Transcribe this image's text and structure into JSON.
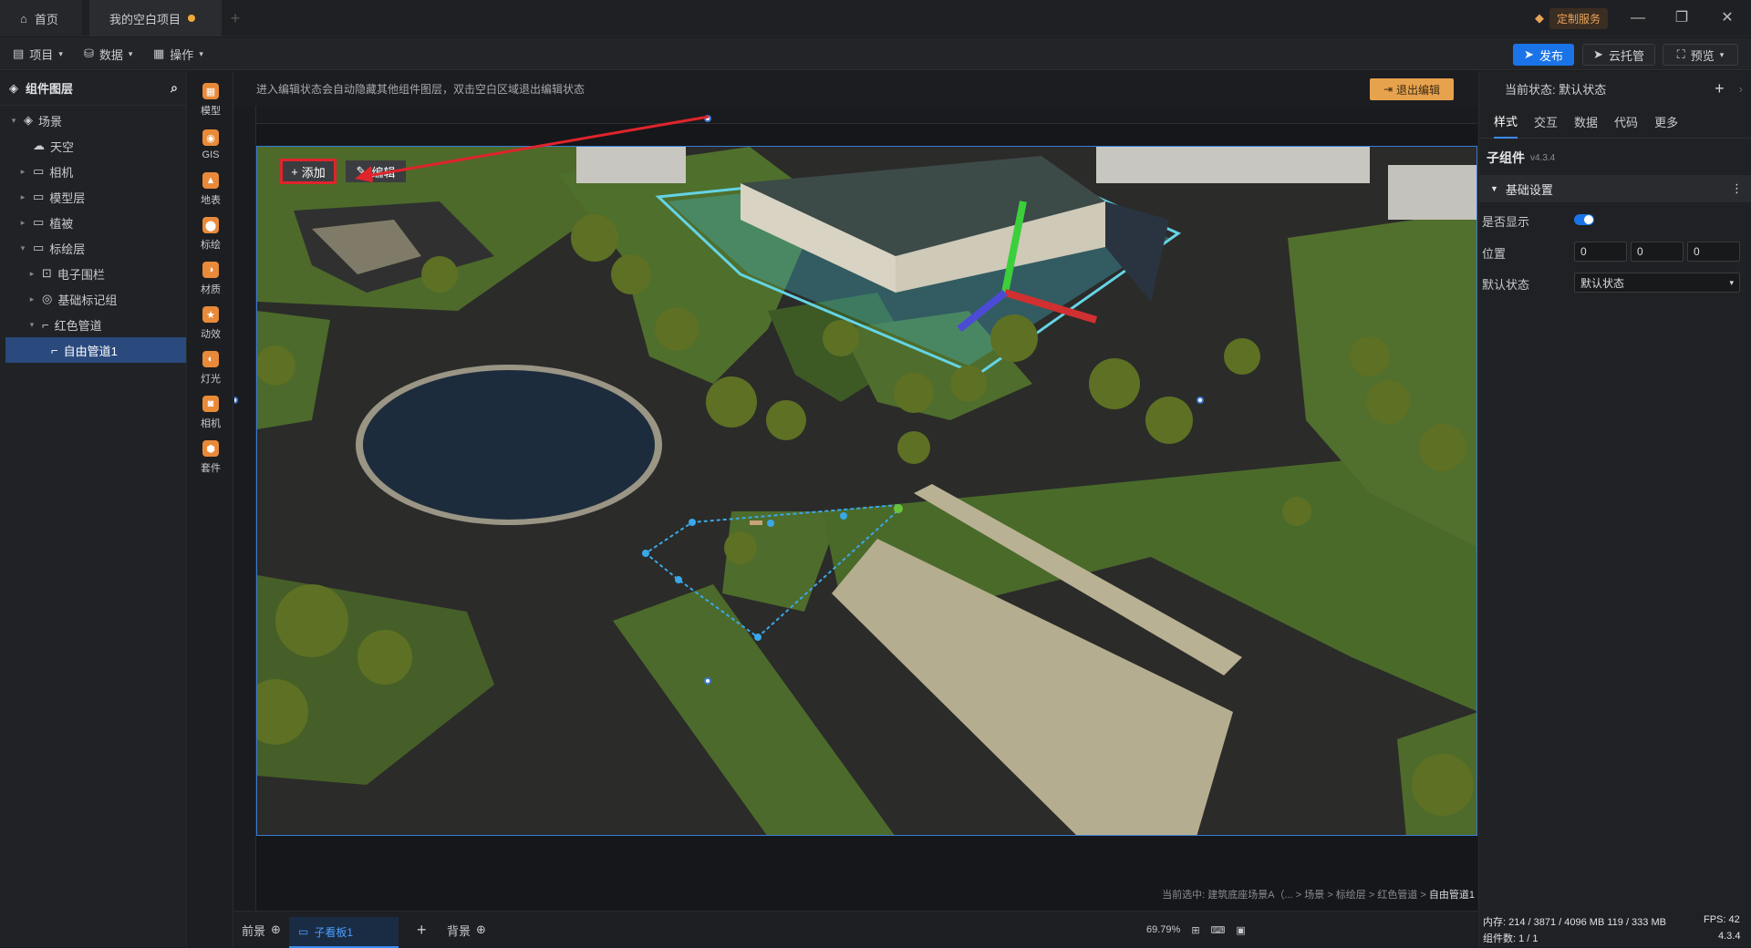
{
  "titlebar": {
    "home_tab": "首页",
    "project_tab": "我的空白项目",
    "custom_service": "定制服务",
    "win_min": "—",
    "win_restore": "❐",
    "win_close": "✕"
  },
  "menubar": {
    "project": "项目",
    "data": "数据",
    "operate": "操作",
    "publish": "发布",
    "cloud": "云托管",
    "preview": "预览"
  },
  "layers": {
    "title": "组件图层",
    "items": [
      {
        "label": "场景",
        "level": 0,
        "arrow": "▾",
        "icon": "◈"
      },
      {
        "label": "天空",
        "level": 1,
        "arrow": "",
        "icon": "☁"
      },
      {
        "label": "相机",
        "level": 1,
        "arrow": "▸",
        "icon": "▭"
      },
      {
        "label": "模型层",
        "level": 1,
        "arrow": "▸",
        "icon": "▭"
      },
      {
        "label": "植被",
        "level": 1,
        "arrow": "▸",
        "icon": "▭"
      },
      {
        "label": "标绘层",
        "level": 1,
        "arrow": "▾",
        "icon": "▭"
      },
      {
        "label": "电子围栏",
        "level": 2,
        "arrow": "▸",
        "icon": "⊡"
      },
      {
        "label": "基础标记组",
        "level": 2,
        "arrow": "▸",
        "icon": "◎"
      },
      {
        "label": "红色管道",
        "level": 2,
        "arrow": "▾",
        "icon": "⌐"
      },
      {
        "label": "自由管道1",
        "level": 3,
        "arrow": "",
        "icon": "⌐"
      }
    ]
  },
  "tools": [
    "模型",
    "GIS",
    "地表",
    "标绘",
    "材质",
    "动效",
    "灯光",
    "相机",
    "套件"
  ],
  "canvas": {
    "notice": "进入编辑状态会自动隐藏其他组件图层，双击空白区域退出编辑状态",
    "exit_edit": "退出编辑",
    "add": "添加",
    "edit": "编辑",
    "breadcrumb_prefix": "当前选中: 建筑底座场景A（... > 场景 > 标绘层 > 红色管道 > ",
    "breadcrumb_current": "自由管道1"
  },
  "bottombar": {
    "front": "前景",
    "subboard": "子看板1",
    "add": "+",
    "back": "背景",
    "zoom": "69.79%"
  },
  "rightpanel": {
    "state_label": "当前状态: 默认状态",
    "tabs": [
      "样式",
      "交互",
      "数据",
      "代码",
      "更多"
    ],
    "subcomponent_title": "子组件",
    "version": "v4.3.4",
    "section": "基础设置",
    "visible_label": "是否显示",
    "position_label": "位置",
    "position": [
      "0",
      "0",
      "0"
    ],
    "default_state_label": "默认状态",
    "default_state_value": "默认状态",
    "visible": true
  },
  "status": {
    "memory": "内存:  214 / 3871 / 4096 MB  119 / 333 MB",
    "fps": "FPS:  42",
    "components": "组件数: 1 / 1",
    "version": "4.3.4"
  },
  "colors": {
    "accent": "#1a74e8",
    "highlight": "#e0242b",
    "exit": "#e7a24d"
  }
}
